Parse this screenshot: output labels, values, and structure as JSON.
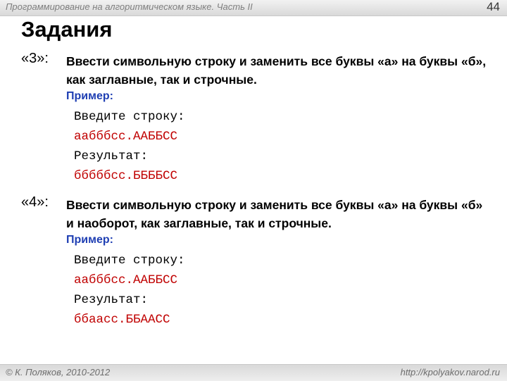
{
  "header": {
    "title": "Программирование на алгоритмическом языке. Часть II",
    "page_number": "44"
  },
  "slide_title": "Задания",
  "tasks": [
    {
      "label": "«3»:",
      "text": "Ввести символьную строку и заменить все буквы «а» на буквы «б», как заглавные, так и строчные.",
      "example_label": "Пример:",
      "input_prompt": "Введите строку:",
      "input_value": "аабббсс.ААББСС",
      "result_prompt": "Результат:",
      "result_value": "бббббсс.ББББСС"
    },
    {
      "label": "«4»:",
      "text": "Ввести символьную строку и заменить все буквы «а» на буквы «б» и наоборот, как заглавные, так и строчные.",
      "example_label": "Пример:",
      "input_prompt": "Введите строку:",
      "input_value": "аабббсс.ААББСС",
      "result_prompt": "Результат:",
      "result_value": "ббаасс.ББААСС"
    }
  ],
  "footer": {
    "copyright": "© К. Поляков, 2010-2012",
    "url": "http://kpolyakov.narod.ru"
  }
}
